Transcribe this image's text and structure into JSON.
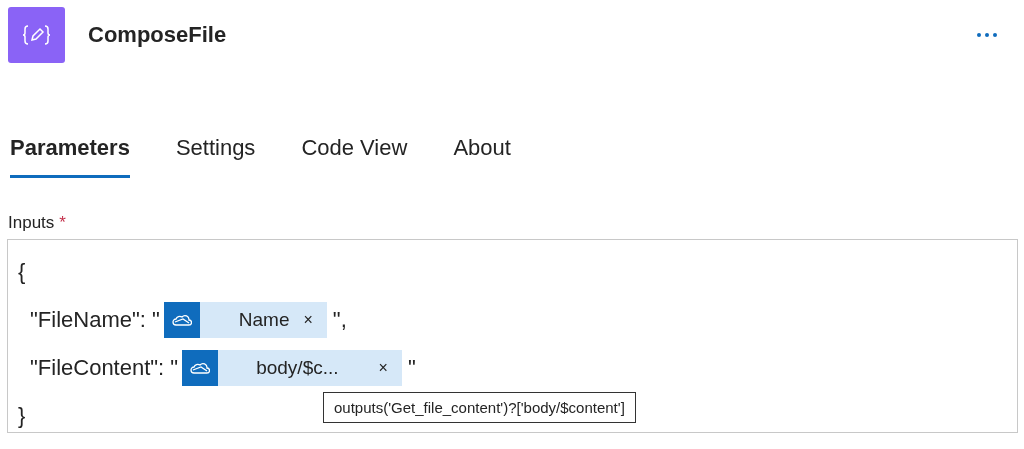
{
  "header": {
    "title": "ComposeFile"
  },
  "tabs": [
    {
      "label": "Parameters",
      "selected": true
    },
    {
      "label": "Settings",
      "selected": false
    },
    {
      "label": "Code View",
      "selected": false
    },
    {
      "label": "About",
      "selected": false
    }
  ],
  "inputs": {
    "label": "Inputs",
    "required_mark": "*",
    "lines": [
      {
        "kind": "text",
        "text": "{"
      },
      {
        "kind": "property",
        "prefix": "\"FileName\": \"",
        "token": {
          "label": "Name",
          "remove": "×"
        },
        "suffix": "\","
      },
      {
        "kind": "property",
        "prefix": "\"FileContent\": \"",
        "token": {
          "label": "body/$c...",
          "remove": "×"
        },
        "suffix": "\""
      },
      {
        "kind": "text",
        "text": "}"
      }
    ],
    "tooltip": "outputs('Get_file_content')?['body/$content']"
  }
}
